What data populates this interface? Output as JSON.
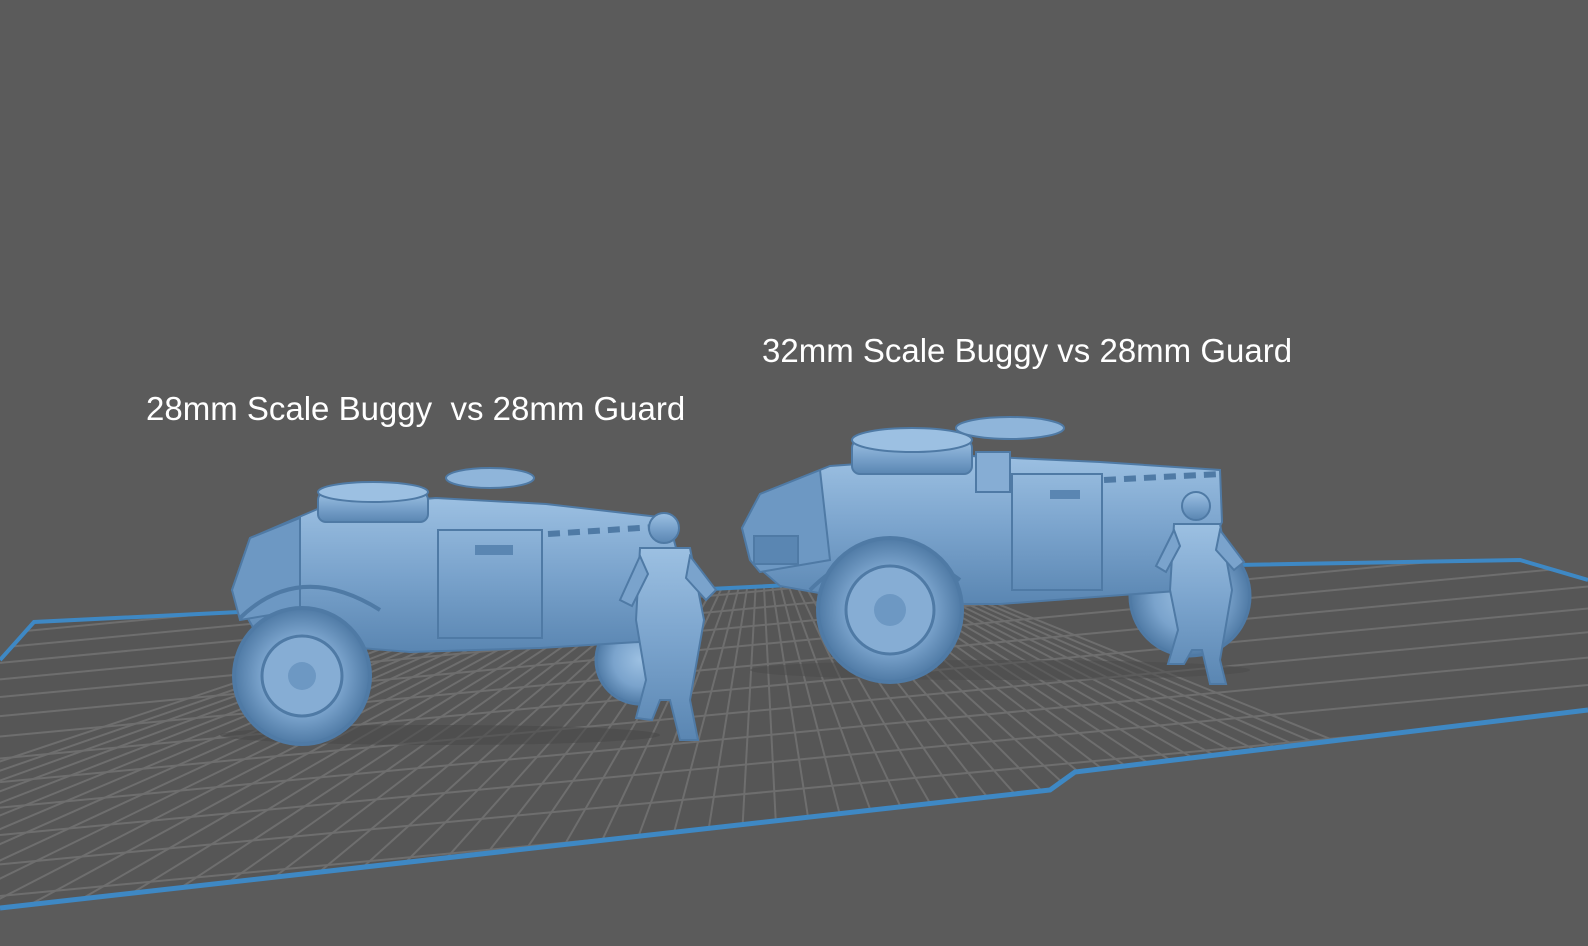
{
  "viewport": {
    "background_color": "#5b5b5b",
    "bed_color": "#555555",
    "bed_grid_color": "#6e6e6e",
    "bed_border_color": "#3e88c4",
    "model_color": "#7aa3cc",
    "model_shade_color": "#4f7aa5",
    "model_highlight_color": "#9cc0e2"
  },
  "captions": {
    "left": "28mm Scale Buggy  vs 28mm Guard",
    "right": "32mm Scale Buggy vs 28mm Guard"
  },
  "models": [
    {
      "name": "28mm Scale Buggy"
    },
    {
      "name": "28mm Guard"
    },
    {
      "name": "32mm Scale Buggy"
    },
    {
      "name": "28mm Guard"
    }
  ]
}
